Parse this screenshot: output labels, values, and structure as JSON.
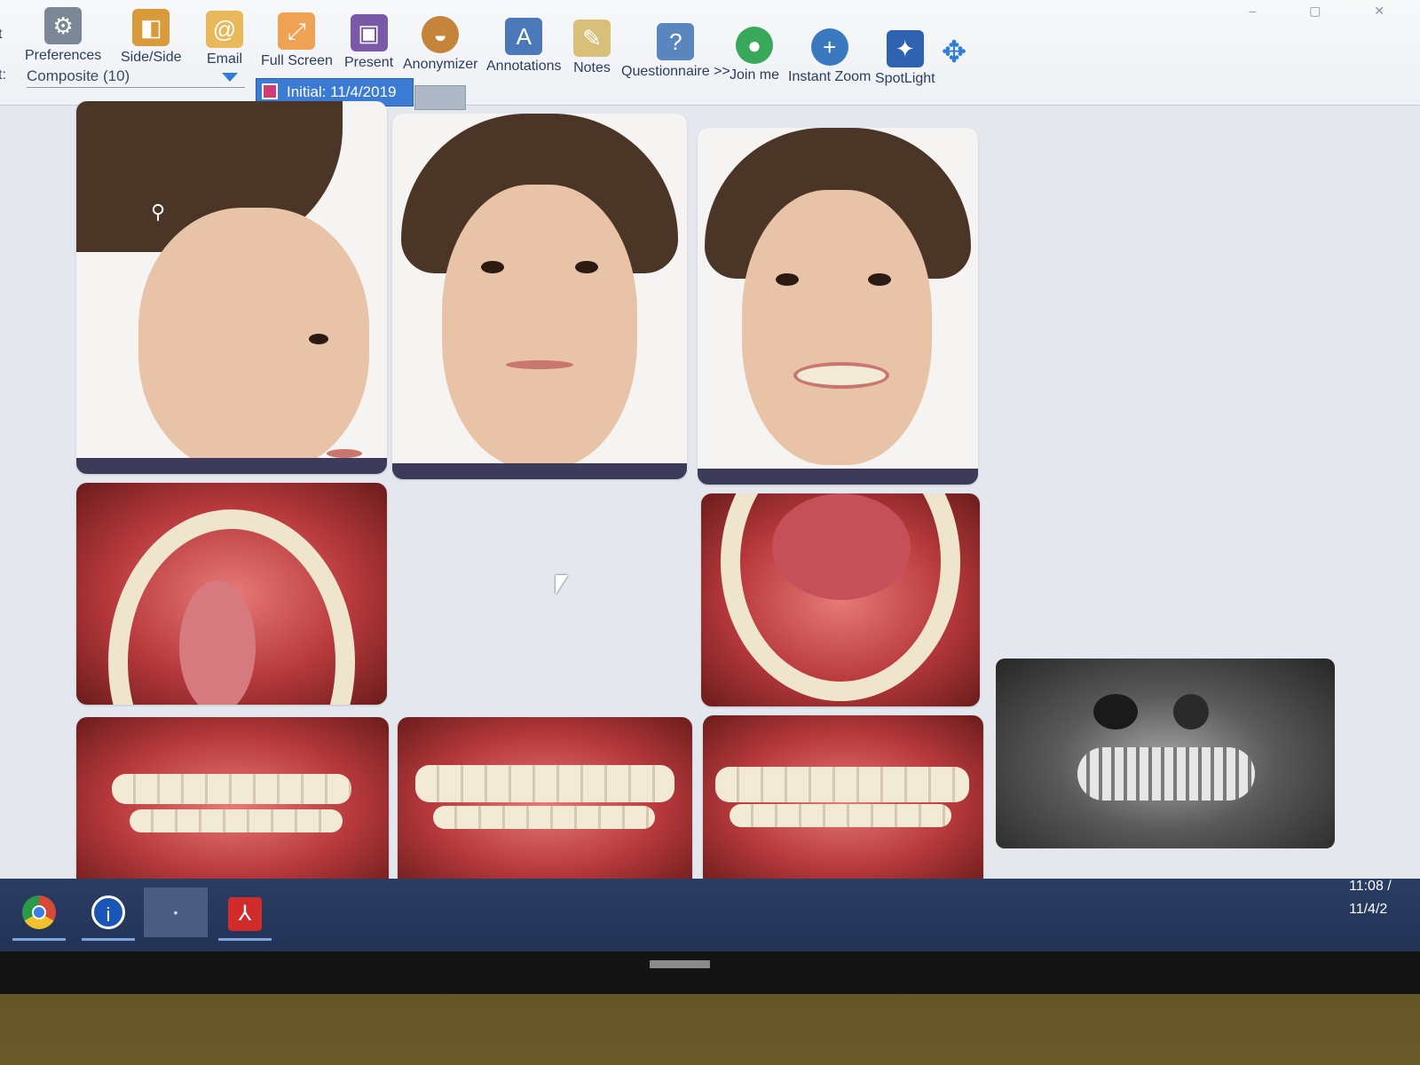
{
  "toolbar": {
    "left_cut_label": "t",
    "items": [
      {
        "label": "Preferences",
        "icon": "gear-icon"
      },
      {
        "label": "Side/Side",
        "icon": "side-by-side-icon"
      },
      {
        "label": "Email",
        "icon": "email-icon"
      },
      {
        "label": "Full Screen",
        "icon": "full-screen-icon"
      },
      {
        "label": "Present",
        "icon": "present-icon"
      },
      {
        "label": "Anonymizer",
        "icon": "anonymizer-icon"
      },
      {
        "label": "Annotations",
        "icon": "annotations-icon"
      },
      {
        "label": "Notes",
        "icon": "notes-icon"
      },
      {
        "label": "Questionnaire >>",
        "icon": "questionnaire-icon"
      },
      {
        "label": "Join me",
        "icon": "join-me-icon"
      },
      {
        "label": "Instant Zoom",
        "icon": "instant-zoom-icon"
      },
      {
        "label": "SpotLight",
        "icon": "spotlight-icon"
      }
    ],
    "row2_label": "t:",
    "layout_select_value": "Composite (10)",
    "tab_initial_label": "Initial: 11/4/2019"
  },
  "taskbar": {
    "apps": [
      {
        "name": "Chrome",
        "icon": "chrome-icon"
      },
      {
        "name": "Imaging app",
        "icon": "app-icon"
      },
      {
        "name": "Blank window",
        "icon": "window-icon"
      },
      {
        "name": "Acrobat",
        "icon": "acrobat-icon"
      }
    ],
    "clock_time": "11:08 /",
    "clock_date": "11/4/2"
  },
  "colors": {
    "ribbon_bg": "#f2f4f7",
    "tab_active": "#3b7bd4",
    "taskbar_bg": "#263a5e",
    "canvas_bg": "#e4e8ee"
  }
}
